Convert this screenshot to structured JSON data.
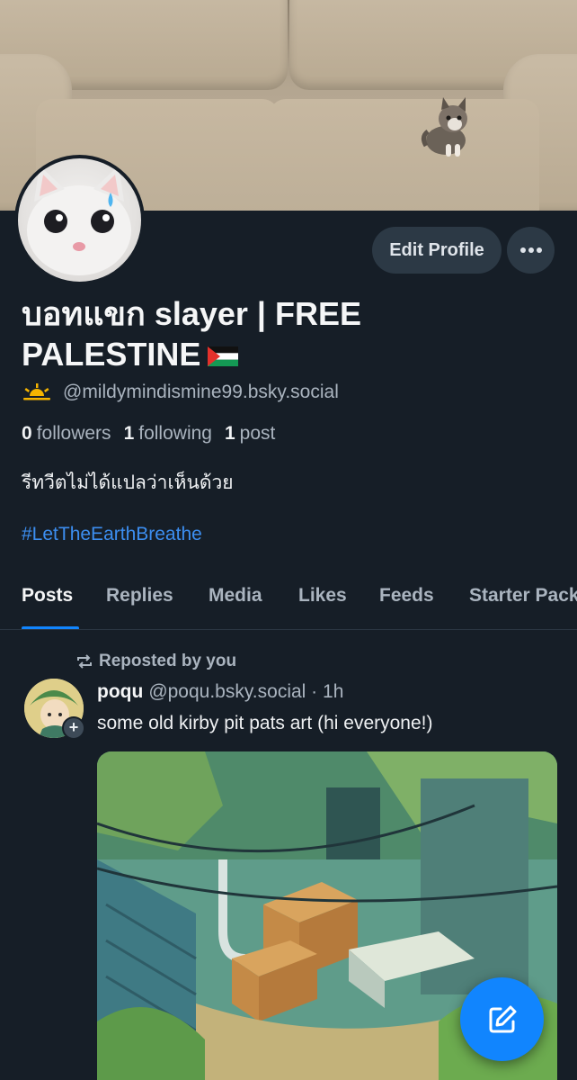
{
  "profile": {
    "display_name": "บอทแขก slayer | FREE PALESTINE",
    "flag_icon": "palestine-flag-icon",
    "status_icon": "sunrise-icon",
    "handle": "@mildymindismine99.bsky.social",
    "followers_count": "0",
    "followers_label": "followers",
    "following_count": "1",
    "following_label": "following",
    "posts_count": "1",
    "posts_label": "post",
    "bio": "รีทวีตไม่ได้แปลว่าเห็นด้วย",
    "hashtag": "#LetTheEarthBreathe"
  },
  "actions": {
    "edit_profile_label": "Edit Profile",
    "more_icon": "ellipsis-icon"
  },
  "tabs": [
    {
      "label": "Posts",
      "active": true
    },
    {
      "label": "Replies",
      "active": false
    },
    {
      "label": "Media",
      "active": false
    },
    {
      "label": "Likes",
      "active": false
    },
    {
      "label": "Feeds",
      "active": false
    },
    {
      "label": "Starter Packs",
      "active": false
    }
  ],
  "post": {
    "repost_label": "Reposted by you",
    "author_name": "poqu",
    "author_handle": "@poqu.bsky.social",
    "separator": "·",
    "time": "1h",
    "text": "some old kirby pit pats art (hi everyone!)"
  },
  "colors": {
    "background": "#161e27",
    "accent": "#1185fe",
    "link": "#3c8ef0"
  }
}
